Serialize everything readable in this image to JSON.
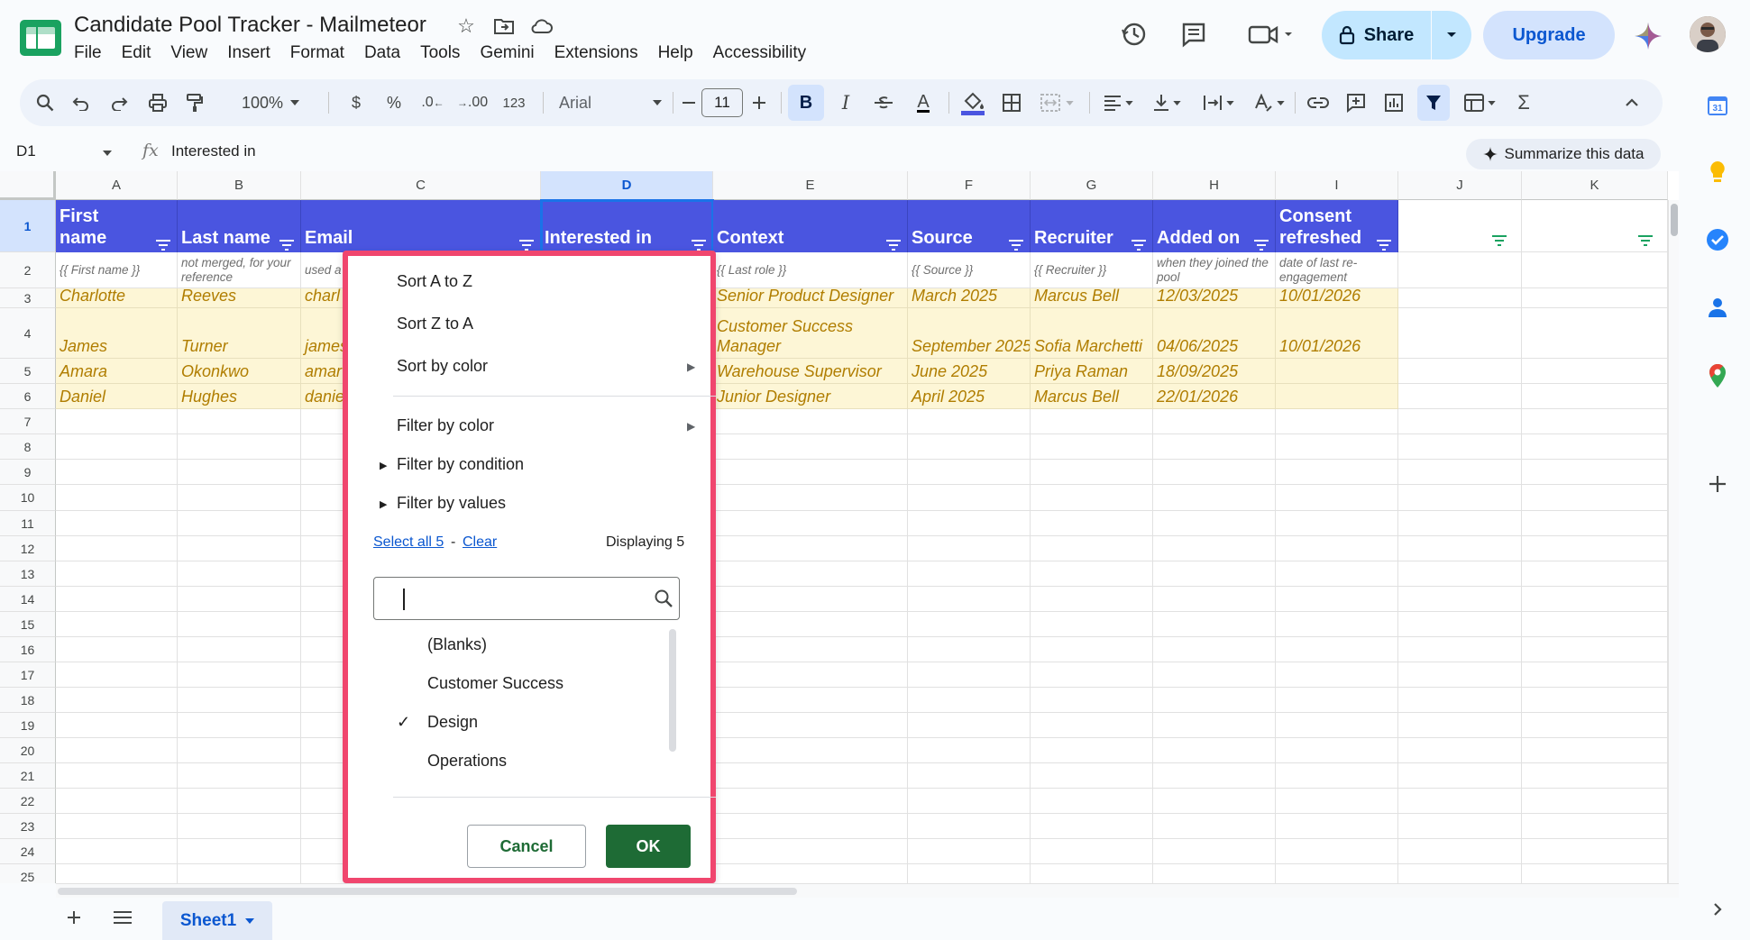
{
  "app": {
    "title": "Candidate Pool Tracker - Mailmeteor",
    "menus": [
      "File",
      "Edit",
      "View",
      "Insert",
      "Format",
      "Data",
      "Tools",
      "Gemini",
      "Extensions",
      "Help",
      "Accessibility"
    ],
    "share_label": "Share",
    "upgrade_label": "Upgrade"
  },
  "toolbar": {
    "zoom": "100%",
    "currency": "$",
    "percent": "%",
    "dec_decrease": ".0",
    "dec_increase": ".00",
    "number_format": "123",
    "font": "Arial",
    "font_size": "11",
    "bold": "B",
    "italic": "I",
    "text_color": "A"
  },
  "formula_bar": {
    "cell_ref": "D1",
    "value": "Interested in",
    "summarize_label": "Summarize this data"
  },
  "columns": [
    "A",
    "B",
    "C",
    "D",
    "E",
    "F",
    "G",
    "H",
    "I",
    "J",
    "K"
  ],
  "rows": [
    "1",
    "2",
    "3",
    "4",
    "5",
    "6",
    "7",
    "8",
    "9",
    "10",
    "11",
    "12",
    "13",
    "14",
    "15",
    "16",
    "17",
    "18",
    "19",
    "20",
    "21",
    "22",
    "23",
    "24",
    "25"
  ],
  "headers": [
    "First name",
    "Last name",
    "Email",
    "Interested in",
    "Context",
    "Source",
    "Recruiter",
    "Added on",
    "Consent refreshed"
  ],
  "notes": [
    "{{ First name }}",
    "not merged, for your reference",
    "used a",
    "",
    "{{ Last role }}",
    "{{ Source }}",
    "{{ Recruiter }}",
    "when they joined the pool",
    "date of last re-engagement"
  ],
  "data_rows": [
    [
      "Charlotte",
      "Reeves",
      "charl",
      "",
      "Senior Product Designer",
      "March 2025",
      "Marcus Bell",
      "12/03/2025",
      "10/01/2026"
    ],
    [
      "James",
      "Turner",
      "james",
      "",
      "Customer Success Manager",
      "September 2025",
      "Sofia Marchetti",
      "04/06/2025",
      "10/01/2026"
    ],
    [
      "Amara",
      "Okonkwo",
      "amar",
      "",
      "Warehouse Supervisor",
      "June 2025",
      "Priya Raman",
      "18/09/2025",
      ""
    ],
    [
      "Daniel",
      "Hughes",
      "danie",
      "",
      "Junior Designer",
      "April 2025",
      "Marcus Bell",
      "22/01/2026",
      ""
    ]
  ],
  "filter_popup": {
    "sort_az": "Sort A to Z",
    "sort_za": "Sort Z to A",
    "sort_by_color": "Sort by color",
    "filter_by_color": "Filter by color",
    "filter_by_condition": "Filter by condition",
    "filter_by_values": "Filter by values",
    "select_all": "Select all 5",
    "separator": "-",
    "clear": "Clear",
    "displaying": "Displaying 5",
    "search_value": "",
    "values": [
      "(Blanks)",
      "Customer Success",
      "Design",
      "Operations"
    ],
    "checked_value": "Design",
    "cancel_label": "Cancel",
    "ok_label": "OK"
  },
  "sheet": {
    "tab_label": "Sheet1"
  },
  "colors": {
    "header_fill": "#4a55e0",
    "data_fill": "#fdf6d6",
    "data_text": "#b07d00",
    "popup_highlight": "#f0466e",
    "ok_button": "#1e6b35"
  }
}
